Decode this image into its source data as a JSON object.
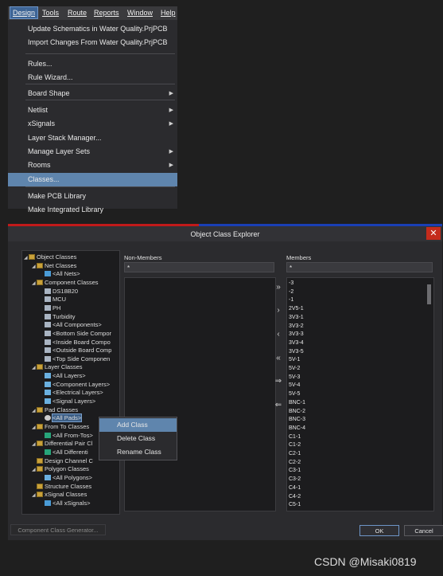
{
  "menubar": [
    "Design",
    "Tools",
    "Route",
    "Reports",
    "Window",
    "Help"
  ],
  "menu_items": [
    {
      "label": "Update Schematics in Water Quality.PrjPCB",
      "submenu": false
    },
    {
      "label": "Import Changes From Water Quality.PrjPCB",
      "submenu": false
    },
    {
      "label": "Rules...",
      "submenu": false
    },
    {
      "label": "Rule Wizard...",
      "submenu": false
    },
    {
      "label": "Board Shape",
      "submenu": true
    },
    {
      "label": "Netlist",
      "submenu": true
    },
    {
      "label": "xSignals",
      "submenu": true
    },
    {
      "label": "Layer Stack Manager...",
      "submenu": false
    },
    {
      "label": "Manage Layer Sets",
      "submenu": true
    },
    {
      "label": "Rooms",
      "submenu": true
    },
    {
      "label": "Classes...",
      "submenu": false,
      "selected": true
    },
    {
      "label": "Make PCB Library",
      "submenu": false
    },
    {
      "label": "Make Integrated Library",
      "submenu": false
    }
  ],
  "dialog": {
    "title": "Object Class Explorer",
    "close_glyph": "✕",
    "nonmembers_label": "Non-Members",
    "members_label": "Members",
    "nonmembers_filter": "*",
    "members_filter": "*",
    "move_buttons": [
      "»",
      "›",
      "‹",
      "«",
      "⇒",
      "⇐"
    ],
    "generator_button": "Component Class Generator...",
    "ok_button": "OK",
    "cancel_button": "Cancel"
  },
  "tree": [
    {
      "label": "Object Classes",
      "icon": "folder-icon",
      "toggle": "◢"
    },
    {
      "label": "Net Classes",
      "icon": "folder-icon",
      "toggle": "◢"
    },
    {
      "label": "<All Nets>",
      "icon": "net-icon",
      "toggle": ""
    },
    {
      "label": "Component Classes",
      "icon": "folder-icon",
      "toggle": "◢"
    },
    {
      "label": "DS18B20",
      "icon": "component-icon",
      "toggle": ""
    },
    {
      "label": "MCU",
      "icon": "component-icon",
      "toggle": ""
    },
    {
      "label": "PH",
      "icon": "component-icon",
      "toggle": ""
    },
    {
      "label": "Turbidity",
      "icon": "component-icon",
      "toggle": ""
    },
    {
      "label": "<All Components>",
      "icon": "component-icon",
      "toggle": ""
    },
    {
      "label": "<Bottom Side Compor",
      "icon": "component-icon",
      "toggle": ""
    },
    {
      "label": "<Inside Board Compo",
      "icon": "component-icon",
      "toggle": ""
    },
    {
      "label": "<Outside Board Comp",
      "icon": "component-icon",
      "toggle": ""
    },
    {
      "label": "<Top Side Componen",
      "icon": "component-icon",
      "toggle": ""
    },
    {
      "label": "Layer Classes",
      "icon": "folder-icon",
      "toggle": "◢"
    },
    {
      "label": "<All Layers>",
      "icon": "layer-icon",
      "toggle": ""
    },
    {
      "label": "<Component Layers>",
      "icon": "layer-icon",
      "toggle": ""
    },
    {
      "label": "<Electrical Layers>",
      "icon": "layer-icon",
      "toggle": ""
    },
    {
      "label": "<Signal Layers>",
      "icon": "layer-icon",
      "toggle": ""
    },
    {
      "label": "Pad Classes",
      "icon": "folder-icon",
      "toggle": "◢"
    },
    {
      "label": "<All Pads>",
      "icon": "pad-icon",
      "toggle": "",
      "selected": true
    },
    {
      "label": "From To Classes",
      "icon": "folder-icon",
      "toggle": "◢"
    },
    {
      "label": "<All From-Tos>",
      "icon": "fromto-icon",
      "toggle": ""
    },
    {
      "label": "Differential Pair Cl",
      "icon": "folder-icon",
      "toggle": "◢"
    },
    {
      "label": "<All Differenti",
      "icon": "fromto-icon",
      "toggle": ""
    },
    {
      "label": "Design Channel C",
      "icon": "folder-icon",
      "toggle": ""
    },
    {
      "label": "Polygon Classes",
      "icon": "folder-icon",
      "toggle": "◢"
    },
    {
      "label": "<All Polygons>",
      "icon": "layer-icon",
      "toggle": ""
    },
    {
      "label": "Structure Classes",
      "icon": "folder-icon",
      "toggle": ""
    },
    {
      "label": "xSignal Classes",
      "icon": "folder-icon",
      "toggle": "◢"
    },
    {
      "label": "<All xSignals>",
      "icon": "net-icon",
      "toggle": ""
    }
  ],
  "context_menu": [
    "Add Class",
    "Delete Class",
    "Rename Class"
  ],
  "members": [
    "-3",
    "-2",
    "-1",
    "2V5-1",
    "3V3-1",
    "3V3-2",
    "3V3-3",
    "3V3-4",
    "3V3-5",
    "5V-1",
    "5V-2",
    "5V-3",
    "5V-4",
    "5V-5",
    "BNC-1",
    "BNC-2",
    "BNC-3",
    "BNC-4",
    "C1-1",
    "C1-2",
    "C2-1",
    "C2-2",
    "C3-1",
    "C3-2",
    "C4-1",
    "C4-2",
    "C5-1"
  ],
  "watermark": "CSDN @Misaki0819",
  "colors": {
    "selection": "#5f85ad",
    "close": "#c42b1c",
    "titlebar_red": "#c11a1a",
    "titlebar_blue": "#1a3fb5"
  }
}
